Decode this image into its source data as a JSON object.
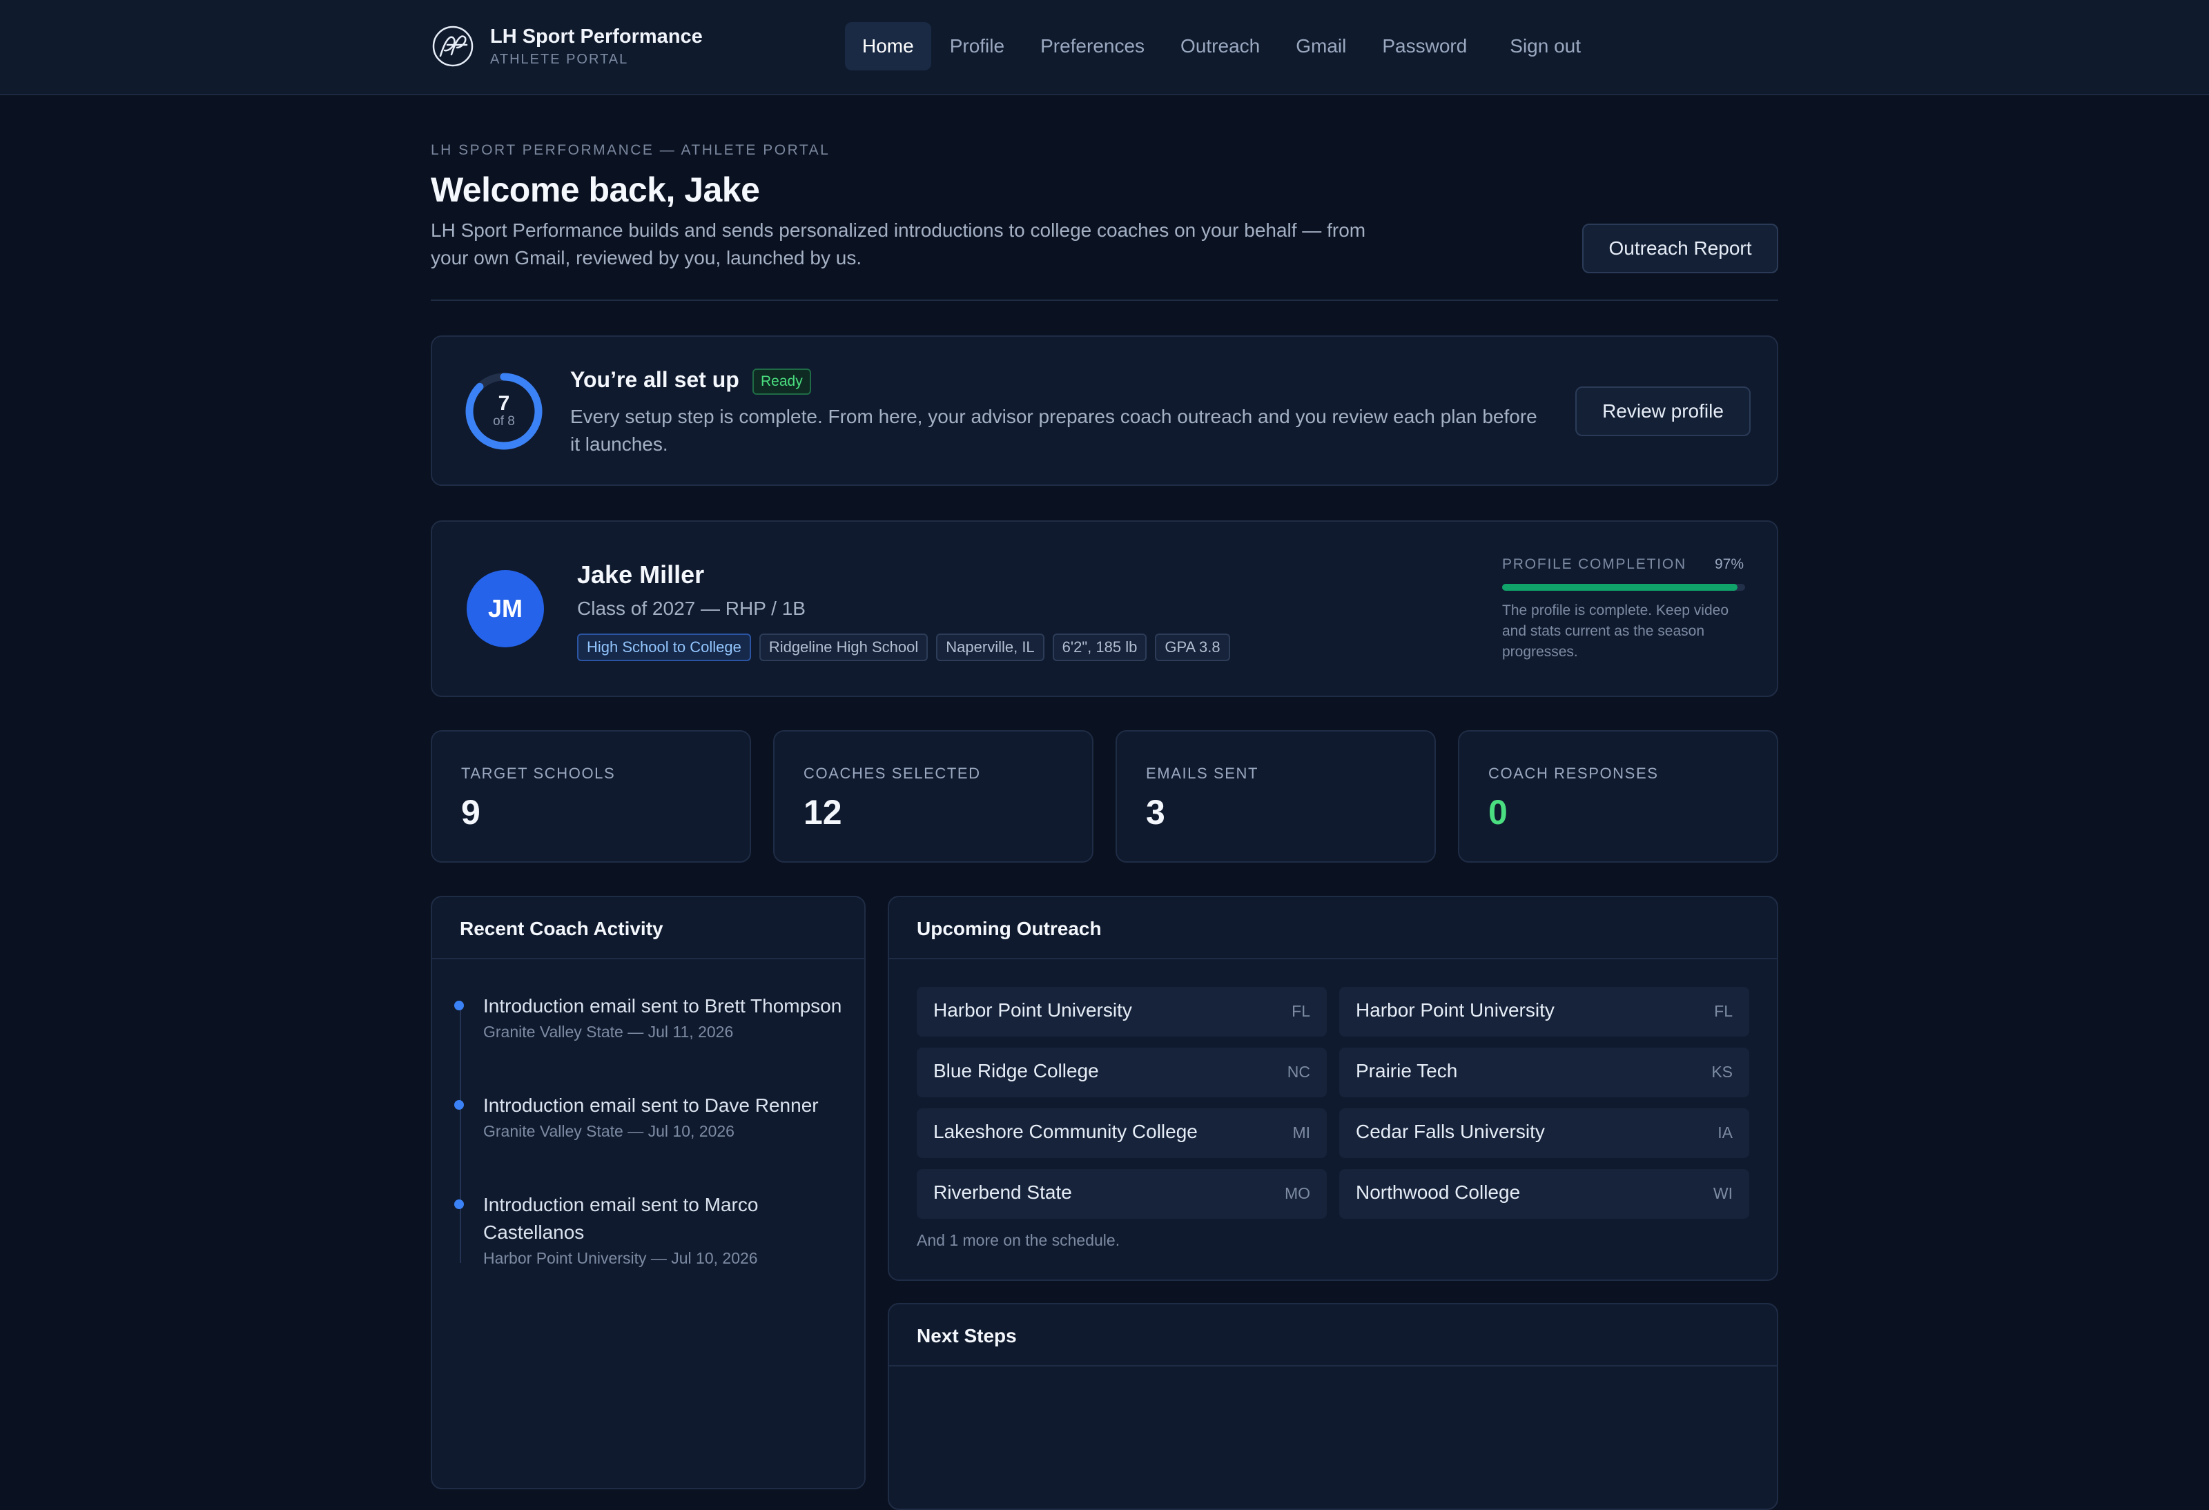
{
  "brand": {
    "name": "LH Sport Performance",
    "subtitle": "ATHLETE PORTAL"
  },
  "nav": {
    "items": [
      {
        "label": "Home",
        "active": true
      },
      {
        "label": "Profile"
      },
      {
        "label": "Preferences"
      },
      {
        "label": "Outreach"
      },
      {
        "label": "Gmail"
      },
      {
        "label": "Password"
      }
    ],
    "signout": "Sign out"
  },
  "header": {
    "eyebrow": "LH SPORT PERFORMANCE — ATHLETE PORTAL",
    "welcome": "Welcome back, Jake",
    "intro": "LH Sport Performance builds and sends personalized introductions to college coaches on your behalf — from your own Gmail, reviewed by you, launched by us.",
    "report_button": "Outreach Report"
  },
  "setup": {
    "steps_done": "7",
    "steps_total_label": "of 8",
    "progress_fraction": 0.875,
    "title": "You’re all set up",
    "badge": "Ready",
    "description": "Every setup step is complete. From here, your advisor prepares coach outreach and you review each plan before it launches.",
    "review_button": "Review profile"
  },
  "athlete": {
    "initials": "JM",
    "name": "Jake Miller",
    "class_line": "Class of 2027 — RHP / 1B",
    "tags": [
      "High School to College",
      "Ridgeline High School",
      "Naperville, IL",
      "6'2\", 185 lb",
      "GPA 3.8"
    ],
    "completion_label": "PROFILE COMPLETION",
    "completion_pct": "97%",
    "completion_value": 0.97,
    "completion_note": "The profile is complete. Keep video and stats current as the season progresses."
  },
  "stats": [
    {
      "label": "TARGET SCHOOLS",
      "value": "9"
    },
    {
      "label": "COACHES SELECTED",
      "value": "12"
    },
    {
      "label": "EMAILS SENT",
      "value": "3"
    },
    {
      "label": "COACH RESPONSES",
      "value": "0"
    }
  ],
  "activity": {
    "title": "Recent Coach Activity",
    "items": [
      {
        "text": "Introduction email sent to Brett Thompson",
        "meta": "Granite Valley State — Jul 11, 2026"
      },
      {
        "text": "Introduction email sent to Dave Renner",
        "meta": "Granite Valley State — Jul 10, 2026"
      },
      {
        "text": "Introduction email sent to Marco Castellanos",
        "meta": "Harbor Point University — Jul 10, 2026"
      }
    ]
  },
  "outreach": {
    "title": "Upcoming Outreach",
    "schools": [
      {
        "name": "Harbor Point University",
        "state": "FL"
      },
      {
        "name": "Harbor Point University",
        "state": "FL"
      },
      {
        "name": "Blue Ridge College",
        "state": "NC"
      },
      {
        "name": "Prairie Tech",
        "state": "KS"
      },
      {
        "name": "Lakeshore Community College",
        "state": "MI"
      },
      {
        "name": "Cedar Falls University",
        "state": "IA"
      },
      {
        "name": "Riverbend State",
        "state": "MO"
      },
      {
        "name": "Northwood College",
        "state": "WI"
      }
    ],
    "more_note": "And 1 more on the schedule."
  },
  "next_steps": {
    "title": "Next Steps"
  },
  "colors": {
    "background": "#0a1120",
    "card": "#0f1a2e",
    "accent_blue": "#3b82f6",
    "success_green": "#4ade80",
    "progress_green": "#10a36a"
  }
}
